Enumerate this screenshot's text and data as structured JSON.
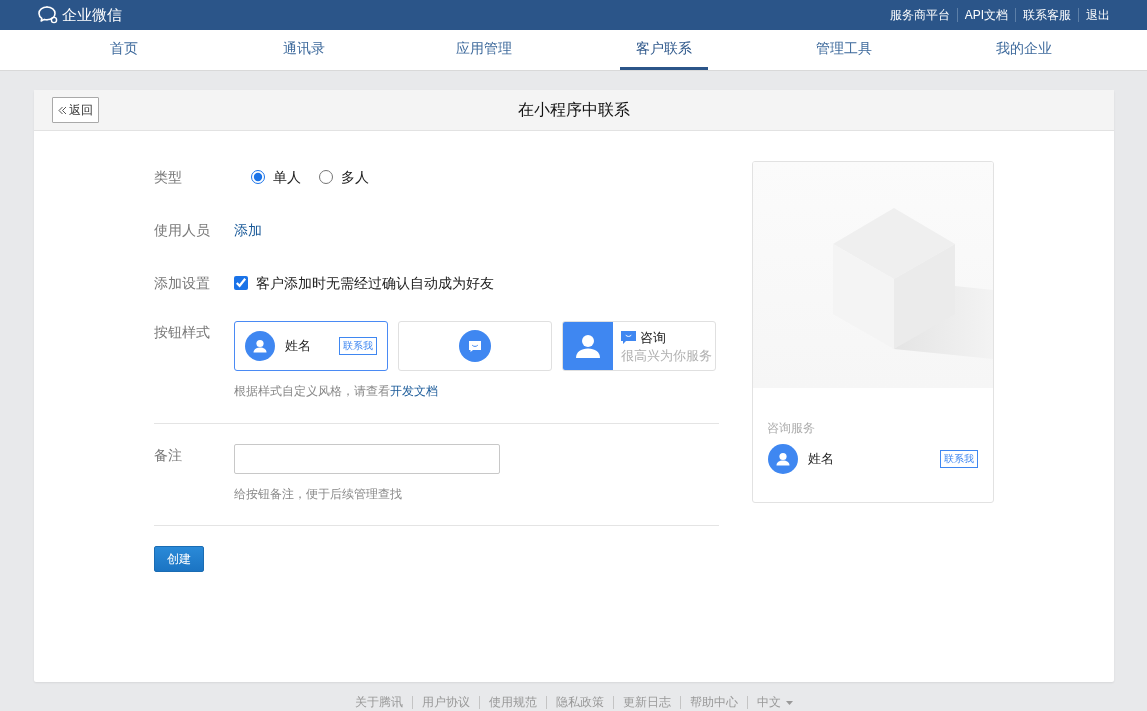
{
  "top_bar": {
    "logo": "企业微信",
    "links": [
      "服务商平台",
      "API文档",
      "联系客服",
      "退出"
    ]
  },
  "nav": {
    "tabs": [
      {
        "label": "首页",
        "selected": false
      },
      {
        "label": "通讯录",
        "selected": false
      },
      {
        "label": "应用管理",
        "selected": false
      },
      {
        "label": "客户联系",
        "selected": true
      },
      {
        "label": "管理工具",
        "selected": false
      },
      {
        "label": "我的企业",
        "selected": false
      }
    ]
  },
  "page": {
    "back": "返回",
    "title": "在小程序中联系"
  },
  "form": {
    "type": {
      "label": "类型",
      "options": [
        {
          "label": "单人",
          "selected": true
        },
        {
          "label": "多人",
          "selected": false
        }
      ]
    },
    "users": {
      "label": "使用人员",
      "action": "添加"
    },
    "settings": {
      "label": "添加设置",
      "option": {
        "label": "客户添加时无需经过确认自动成为好友",
        "checked": true
      }
    },
    "button_style": {
      "label": "按钮样式",
      "styles": [
        {
          "kind": "name",
          "selected": true,
          "name": "姓名",
          "badge": "联系我"
        },
        {
          "kind": "icon",
          "selected": false
        },
        {
          "kind": "banner",
          "selected": false,
          "title": "咨询",
          "subtitle": "很高兴为你服务"
        }
      ],
      "hint": "根据样式自定义风格，请查看",
      "hint_link": "开发文档"
    },
    "note": {
      "label": "备注",
      "hint": "给按钮备注，便于后续管理查找"
    },
    "submit": "创建"
  },
  "preview": {
    "heading": "咨询服务",
    "name": "姓名",
    "badge": "联系我"
  },
  "footer": {
    "links": [
      "关于腾讯",
      "用户协议",
      "使用规范",
      "隐私政策",
      "更新日志",
      "帮助中心"
    ],
    "language": "中文"
  }
}
